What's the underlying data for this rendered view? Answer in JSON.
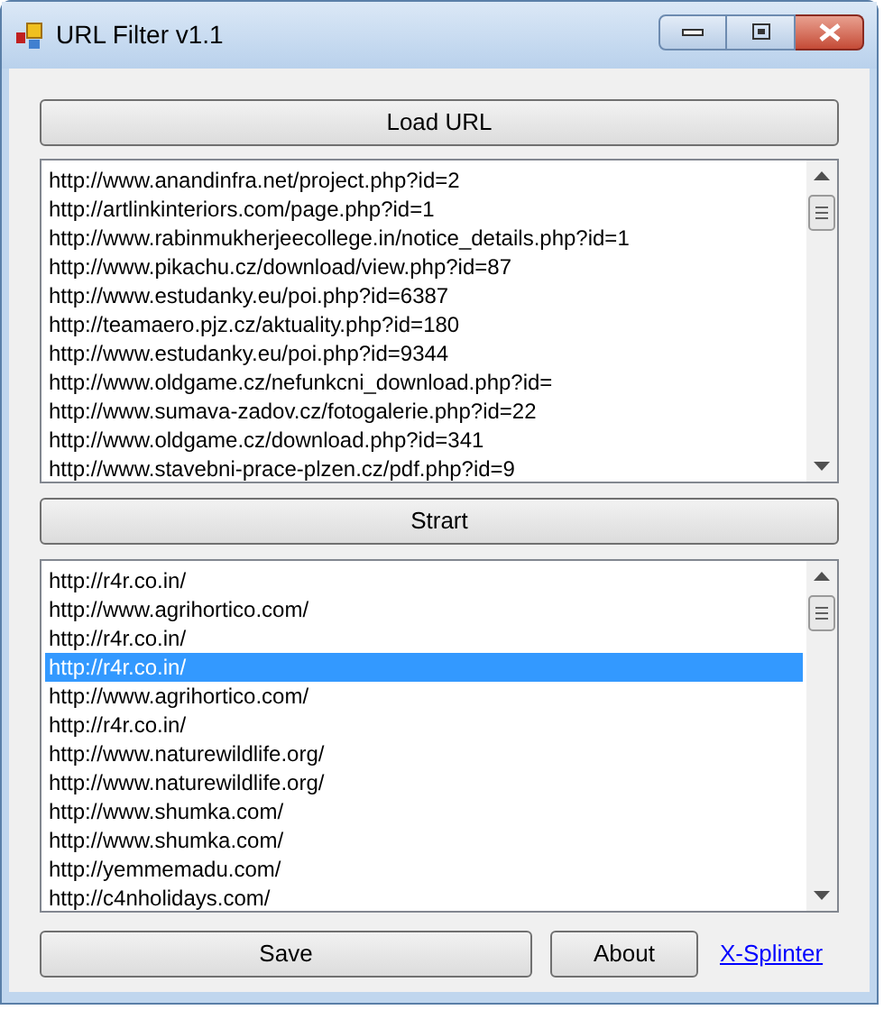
{
  "window": {
    "title": "URL Filter v1.1"
  },
  "load_button": "Load URL",
  "input_list": [
    {
      "text": "http://www.anandinfra.net/project.php?id=2",
      "selected": false
    },
    {
      "text": "http://artlinkinteriors.com/page.php?id=1",
      "selected": false
    },
    {
      "text": "http://www.rabinmukherjeecollege.in/notice_details.php?id=1",
      "selected": false
    },
    {
      "text": "http://www.pikachu.cz/download/view.php?id=87",
      "selected": false
    },
    {
      "text": "http://www.estudanky.eu/poi.php?id=6387",
      "selected": false
    },
    {
      "text": "http://teamaero.pjz.cz/aktuality.php?id=180",
      "selected": false
    },
    {
      "text": "http://www.estudanky.eu/poi.php?id=9344",
      "selected": false
    },
    {
      "text": "http://www.oldgame.cz/nefunkcni_download.php?id=",
      "selected": false
    },
    {
      "text": "http://www.sumava-zadov.cz/fotogalerie.php?id=22",
      "selected": false
    },
    {
      "text": "http://www.oldgame.cz/download.php?id=341",
      "selected": false
    },
    {
      "text": "http://www.stavebni-prace-plzen.cz/pdf.php?id=9",
      "selected": false
    }
  ],
  "start_button": "Strart",
  "output_list": [
    {
      "text": "http://r4r.co.in/",
      "selected": false
    },
    {
      "text": "http://www.agrihortico.com/",
      "selected": false
    },
    {
      "text": "http://r4r.co.in/",
      "selected": false
    },
    {
      "text": "http://r4r.co.in/",
      "selected": true
    },
    {
      "text": "http://www.agrihortico.com/",
      "selected": false
    },
    {
      "text": "http://r4r.co.in/",
      "selected": false
    },
    {
      "text": "http://www.naturewildlife.org/",
      "selected": false
    },
    {
      "text": "http://www.naturewildlife.org/",
      "selected": false
    },
    {
      "text": "http://www.shumka.com/",
      "selected": false
    },
    {
      "text": "http://www.shumka.com/",
      "selected": false
    },
    {
      "text": "http://yemmemadu.com/",
      "selected": false
    },
    {
      "text": "http://c4nholidays.com/",
      "selected": false
    }
  ],
  "save_button": "Save",
  "about_button": "About",
  "link": "X-Splinter"
}
